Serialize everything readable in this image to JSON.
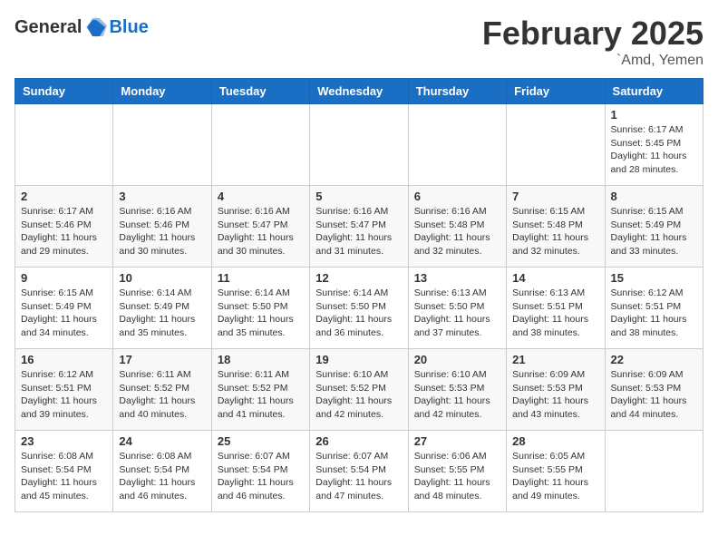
{
  "header": {
    "logo_general": "General",
    "logo_blue": "Blue",
    "month_title": "February 2025",
    "location": "`Amd, Yemen"
  },
  "days_of_week": [
    "Sunday",
    "Monday",
    "Tuesday",
    "Wednesday",
    "Thursday",
    "Friday",
    "Saturday"
  ],
  "weeks": [
    [
      {
        "day": "",
        "info": ""
      },
      {
        "day": "",
        "info": ""
      },
      {
        "day": "",
        "info": ""
      },
      {
        "day": "",
        "info": ""
      },
      {
        "day": "",
        "info": ""
      },
      {
        "day": "",
        "info": ""
      },
      {
        "day": "1",
        "info": "Sunrise: 6:17 AM\nSunset: 5:45 PM\nDaylight: 11 hours\nand 28 minutes."
      }
    ],
    [
      {
        "day": "2",
        "info": "Sunrise: 6:17 AM\nSunset: 5:46 PM\nDaylight: 11 hours\nand 29 minutes."
      },
      {
        "day": "3",
        "info": "Sunrise: 6:16 AM\nSunset: 5:46 PM\nDaylight: 11 hours\nand 30 minutes."
      },
      {
        "day": "4",
        "info": "Sunrise: 6:16 AM\nSunset: 5:47 PM\nDaylight: 11 hours\nand 30 minutes."
      },
      {
        "day": "5",
        "info": "Sunrise: 6:16 AM\nSunset: 5:47 PM\nDaylight: 11 hours\nand 31 minutes."
      },
      {
        "day": "6",
        "info": "Sunrise: 6:16 AM\nSunset: 5:48 PM\nDaylight: 11 hours\nand 32 minutes."
      },
      {
        "day": "7",
        "info": "Sunrise: 6:15 AM\nSunset: 5:48 PM\nDaylight: 11 hours\nand 32 minutes."
      },
      {
        "day": "8",
        "info": "Sunrise: 6:15 AM\nSunset: 5:49 PM\nDaylight: 11 hours\nand 33 minutes."
      }
    ],
    [
      {
        "day": "9",
        "info": "Sunrise: 6:15 AM\nSunset: 5:49 PM\nDaylight: 11 hours\nand 34 minutes."
      },
      {
        "day": "10",
        "info": "Sunrise: 6:14 AM\nSunset: 5:49 PM\nDaylight: 11 hours\nand 35 minutes."
      },
      {
        "day": "11",
        "info": "Sunrise: 6:14 AM\nSunset: 5:50 PM\nDaylight: 11 hours\nand 35 minutes."
      },
      {
        "day": "12",
        "info": "Sunrise: 6:14 AM\nSunset: 5:50 PM\nDaylight: 11 hours\nand 36 minutes."
      },
      {
        "day": "13",
        "info": "Sunrise: 6:13 AM\nSunset: 5:50 PM\nDaylight: 11 hours\nand 37 minutes."
      },
      {
        "day": "14",
        "info": "Sunrise: 6:13 AM\nSunset: 5:51 PM\nDaylight: 11 hours\nand 38 minutes."
      },
      {
        "day": "15",
        "info": "Sunrise: 6:12 AM\nSunset: 5:51 PM\nDaylight: 11 hours\nand 38 minutes."
      }
    ],
    [
      {
        "day": "16",
        "info": "Sunrise: 6:12 AM\nSunset: 5:51 PM\nDaylight: 11 hours\nand 39 minutes."
      },
      {
        "day": "17",
        "info": "Sunrise: 6:11 AM\nSunset: 5:52 PM\nDaylight: 11 hours\nand 40 minutes."
      },
      {
        "day": "18",
        "info": "Sunrise: 6:11 AM\nSunset: 5:52 PM\nDaylight: 11 hours\nand 41 minutes."
      },
      {
        "day": "19",
        "info": "Sunrise: 6:10 AM\nSunset: 5:52 PM\nDaylight: 11 hours\nand 42 minutes."
      },
      {
        "day": "20",
        "info": "Sunrise: 6:10 AM\nSunset: 5:53 PM\nDaylight: 11 hours\nand 42 minutes."
      },
      {
        "day": "21",
        "info": "Sunrise: 6:09 AM\nSunset: 5:53 PM\nDaylight: 11 hours\nand 43 minutes."
      },
      {
        "day": "22",
        "info": "Sunrise: 6:09 AM\nSunset: 5:53 PM\nDaylight: 11 hours\nand 44 minutes."
      }
    ],
    [
      {
        "day": "23",
        "info": "Sunrise: 6:08 AM\nSunset: 5:54 PM\nDaylight: 11 hours\nand 45 minutes."
      },
      {
        "day": "24",
        "info": "Sunrise: 6:08 AM\nSunset: 5:54 PM\nDaylight: 11 hours\nand 46 minutes."
      },
      {
        "day": "25",
        "info": "Sunrise: 6:07 AM\nSunset: 5:54 PM\nDaylight: 11 hours\nand 46 minutes."
      },
      {
        "day": "26",
        "info": "Sunrise: 6:07 AM\nSunset: 5:54 PM\nDaylight: 11 hours\nand 47 minutes."
      },
      {
        "day": "27",
        "info": "Sunrise: 6:06 AM\nSunset: 5:55 PM\nDaylight: 11 hours\nand 48 minutes."
      },
      {
        "day": "28",
        "info": "Sunrise: 6:05 AM\nSunset: 5:55 PM\nDaylight: 11 hours\nand 49 minutes."
      },
      {
        "day": "",
        "info": ""
      }
    ]
  ]
}
